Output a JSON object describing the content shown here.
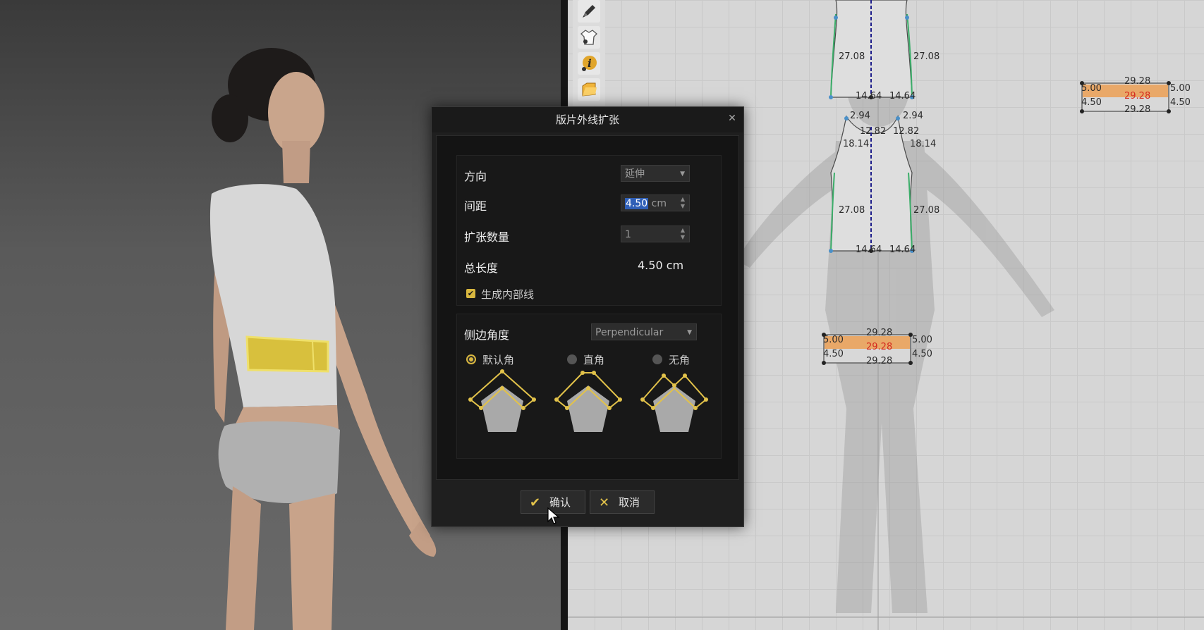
{
  "dialog": {
    "title": "版片外线扩张",
    "direction_label": "方向",
    "direction_value": "延伸",
    "spacing_label": "间距",
    "spacing_value": "4.50",
    "spacing_unit": "cm",
    "count_label": "扩张数量",
    "count_value": "1",
    "total_label": "总长度",
    "total_value": "4.50 cm",
    "generate_inner_label": "生成内部线",
    "generate_inner_checked": true,
    "side_angle_label": "侧边角度",
    "side_angle_value": "Perpendicular",
    "corner_options": [
      {
        "label": "默认角",
        "selected": true
      },
      {
        "label": "直角",
        "selected": false
      },
      {
        "label": "无角",
        "selected": false
      }
    ],
    "confirm_label": "确认",
    "cancel_label": "取消"
  },
  "pattern_measurements": {
    "top_sides": [
      "27.08",
      "27.08",
      "14.64",
      "14.64"
    ],
    "shoulder": [
      "2.94",
      "2.94",
      "12.82",
      "12.82",
      "18.14",
      "18.14"
    ],
    "mid_sides": [
      "27.08",
      "27.08",
      "14.64",
      "14.64"
    ],
    "band_center": [
      "29.28",
      "29.28",
      "29.28",
      "5.00",
      "5.00",
      "4.50",
      "4.50"
    ],
    "band_right": [
      "29.28",
      "29.28",
      "29.28",
      "5.00",
      "5.00",
      "4.50",
      "4.50"
    ]
  },
  "colors": {
    "accent": "#d9b73f",
    "band_fill": "#e9a868",
    "selection": "#2f5fb7"
  },
  "toolbar_icons": [
    "pencil-icon",
    "garment-icon",
    "info-icon",
    "folder-icon"
  ]
}
